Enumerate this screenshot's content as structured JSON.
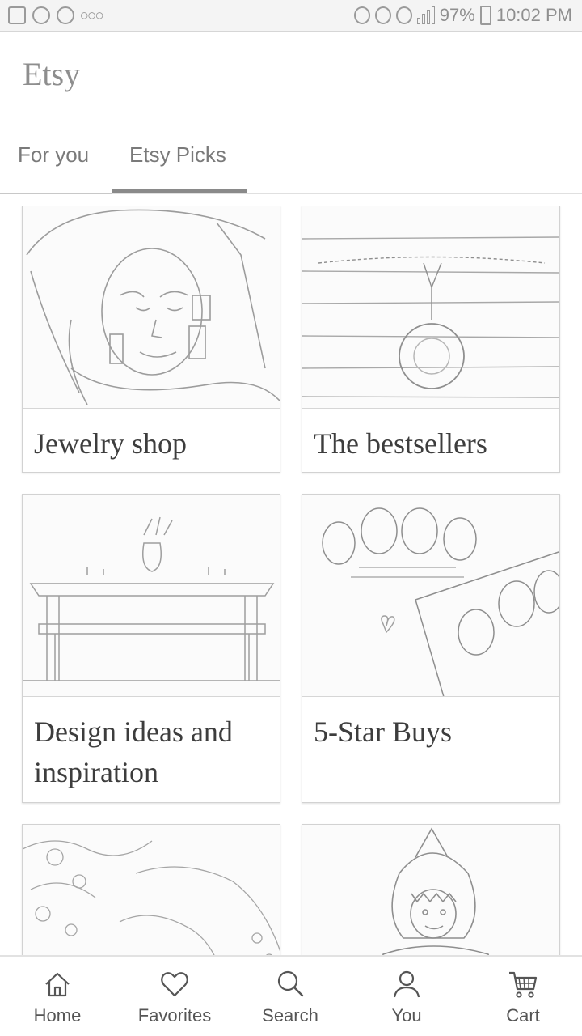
{
  "status_bar": {
    "battery": "97%",
    "time": "10:02 PM"
  },
  "app": {
    "title": "Etsy"
  },
  "tabs": [
    {
      "label": "For you",
      "selected": false
    },
    {
      "label": "Etsy Picks",
      "selected": true
    }
  ],
  "cards": [
    {
      "label": "Jewelry shop",
      "image": "woman-with-earrings"
    },
    {
      "label": "The bestsellers",
      "image": "pendant-necklace-on-wood"
    },
    {
      "label": "Design ideas and inspiration",
      "image": "dining-table-with-vase"
    },
    {
      "label": "5-Star Buys",
      "image": "custom-family-portrait-prints"
    },
    {
      "label": "",
      "image": "woman-with-floral-background"
    },
    {
      "label": "",
      "image": "child-in-shark-hood"
    }
  ],
  "bottom_nav": [
    {
      "label": "Home",
      "icon": "home-icon"
    },
    {
      "label": "Favorites",
      "icon": "heart-icon"
    },
    {
      "label": "Search",
      "icon": "search-icon"
    },
    {
      "label": "You",
      "icon": "user-icon"
    },
    {
      "label": "Cart",
      "icon": "cart-icon"
    }
  ],
  "colors": {
    "text_primary": "#3d3d3d",
    "text_secondary": "#7a7a7a",
    "tab_indicator": "#8a8a8a",
    "divider": "#e0e0e0"
  }
}
